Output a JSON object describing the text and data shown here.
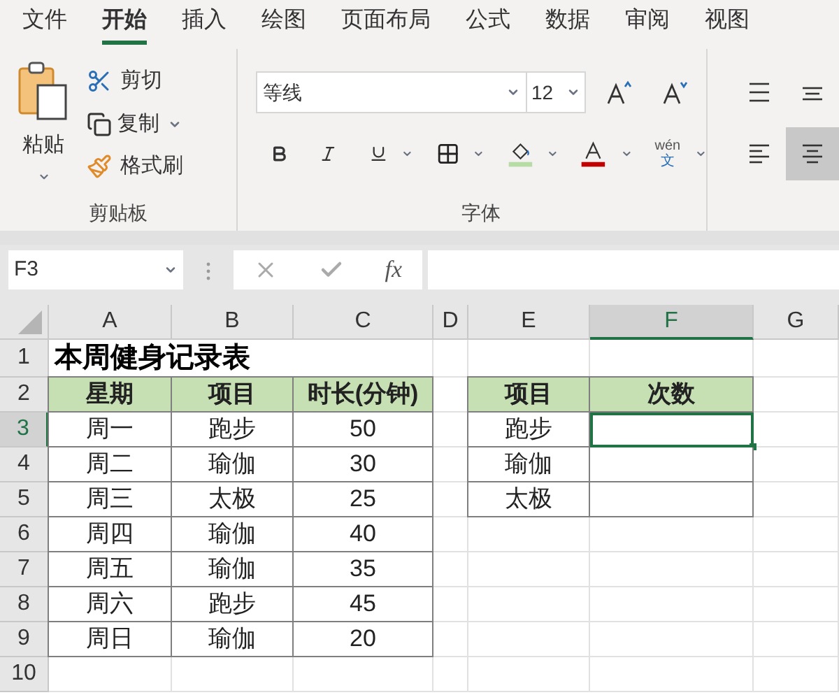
{
  "ribbon": {
    "tabs": [
      {
        "label": "文件",
        "selected": false
      },
      {
        "label": "开始",
        "selected": true
      },
      {
        "label": "插入",
        "selected": false
      },
      {
        "label": "绘图",
        "selected": false
      },
      {
        "label": "页面布局",
        "selected": false
      },
      {
        "label": "公式",
        "selected": false
      },
      {
        "label": "数据",
        "selected": false
      },
      {
        "label": "审阅",
        "selected": false
      },
      {
        "label": "视图",
        "selected": false
      }
    ],
    "clipboard": {
      "paste": "粘贴",
      "cut": "剪切",
      "copy": "复制",
      "format_painter": "格式刷",
      "group_label": "剪贴板"
    },
    "font": {
      "name": "等线",
      "size": "12",
      "phonetic": "wén",
      "phonetic_char": "文",
      "group_label": "字体"
    },
    "alignment": [
      {
        "kind": "top",
        "selected": false
      },
      {
        "kind": "middle",
        "selected": false
      },
      {
        "kind": "left",
        "selected": false
      },
      {
        "kind": "center",
        "selected": true
      }
    ]
  },
  "formula_bar": {
    "name_box": "F3",
    "function_label": "fx"
  },
  "sheet": {
    "columns": [
      {
        "label": "A",
        "selected": false
      },
      {
        "label": "B",
        "selected": false
      },
      {
        "label": "C",
        "selected": false
      },
      {
        "label": "D",
        "selected": false
      },
      {
        "label": "E",
        "selected": false
      },
      {
        "label": "F",
        "selected": true
      },
      {
        "label": "G",
        "selected": false
      }
    ],
    "rows": [
      {
        "label": "1",
        "selected": false
      },
      {
        "label": "2",
        "selected": false
      },
      {
        "label": "3",
        "selected": true
      },
      {
        "label": "4",
        "selected": false
      },
      {
        "label": "5",
        "selected": false
      },
      {
        "label": "6",
        "selected": false
      },
      {
        "label": "7",
        "selected": false
      },
      {
        "label": "8",
        "selected": false
      },
      {
        "label": "9",
        "selected": false
      },
      {
        "label": "10",
        "selected": false
      }
    ],
    "title": "本周健身记录表",
    "log_table": {
      "headers": [
        "星期",
        "项目",
        "时长(分钟)"
      ],
      "rows": [
        [
          "周一",
          "跑步",
          "50"
        ],
        [
          "周二",
          "瑜伽",
          "30"
        ],
        [
          "周三",
          "太极",
          "25"
        ],
        [
          "周四",
          "瑜伽",
          "40"
        ],
        [
          "周五",
          "瑜伽",
          "35"
        ],
        [
          "周六",
          "跑步",
          "45"
        ],
        [
          "周日",
          "瑜伽",
          "20"
        ]
      ]
    },
    "count_table": {
      "headers": [
        "项目",
        "次数"
      ],
      "rows": [
        {
          "item": "跑步",
          "selected": true
        },
        {
          "item": "瑜伽",
          "selected": false
        },
        {
          "item": "太极",
          "selected": false
        }
      ]
    }
  }
}
